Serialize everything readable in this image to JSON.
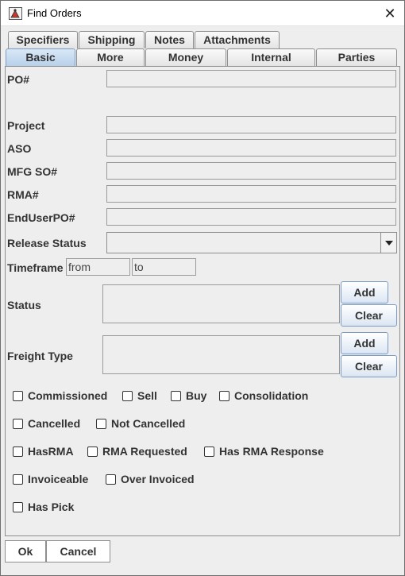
{
  "window": {
    "title": "Find Orders",
    "close_glyph": "✕"
  },
  "tabs_row1": [
    {
      "label": "Specifiers"
    },
    {
      "label": "Shipping"
    },
    {
      "label": "Notes"
    },
    {
      "label": "Attachments"
    }
  ],
  "tabs_row2": [
    {
      "label": "Basic",
      "active": true
    },
    {
      "label": "More"
    },
    {
      "label": "Money"
    },
    {
      "label": "Internal"
    },
    {
      "label": "Parties"
    }
  ],
  "form": {
    "po_label": "PO#",
    "po_value": "",
    "project_label": "Project",
    "project_value": "",
    "aso_label": "ASO",
    "aso_value": "",
    "mfg_label": "MFG SO#",
    "mfg_value": "",
    "rma_label": "RMA#",
    "rma_value": "",
    "enduser_label": "EndUserPO#",
    "enduser_value": "",
    "release_label": "Release Status",
    "release_value": "",
    "timeframe_label": "Timeframe",
    "from_value": "from",
    "to_value": "to",
    "status_label": "Status",
    "freight_label": "Freight Type",
    "add_label": "Add",
    "clear_label": "Clear"
  },
  "checkboxes": [
    {
      "label": "Commissioned",
      "checked": false
    },
    {
      "label": "Sell",
      "checked": false
    },
    {
      "label": "Buy",
      "checked": false
    },
    {
      "label": "Consolidation",
      "checked": false
    },
    {
      "label": "Cancelled",
      "checked": false
    },
    {
      "label": "Not Cancelled",
      "checked": false
    },
    {
      "label": "HasRMA",
      "checked": false
    },
    {
      "label": "RMA Requested",
      "checked": false
    },
    {
      "label": "Has RMA Response",
      "checked": false
    },
    {
      "label": "Invoiceable",
      "checked": false
    },
    {
      "label": "Over Invoiced",
      "checked": false
    },
    {
      "label": "Has Pick",
      "checked": false
    }
  ],
  "footer": {
    "ok_label": "Ok",
    "cancel_label": "Cancel"
  }
}
